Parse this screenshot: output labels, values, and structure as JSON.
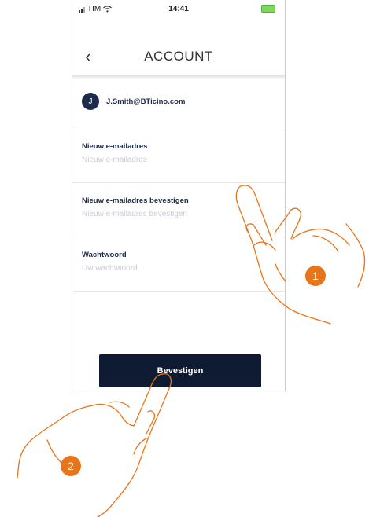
{
  "status_bar": {
    "carrier": "TIM",
    "time": "14:41"
  },
  "header": {
    "back_icon": "chevron-left-icon",
    "title": "ACCOUNT"
  },
  "user": {
    "avatar_initial": "J",
    "email": "J.Smith@BTicino.com"
  },
  "form": {
    "new_email": {
      "label": "Nieuw e-mailadres",
      "placeholder": "Nieuw e-mailadres",
      "value": ""
    },
    "confirm_email": {
      "label": "Nieuw e-mailadres bevestigen",
      "placeholder": "Nieuw e-mailadres bevestigen",
      "value": ""
    },
    "password": {
      "label": "Wachtwoord",
      "placeholder": "Uw wachtwoord",
      "value": ""
    }
  },
  "confirm_button": {
    "label": "Bevestigen"
  },
  "callouts": {
    "step1": "1",
    "step2": "2",
    "color": "#e8751a"
  },
  "colors": {
    "primary": "#0f1a33",
    "accent": "#e8751a"
  }
}
